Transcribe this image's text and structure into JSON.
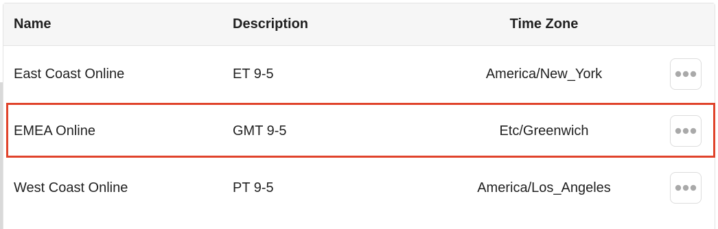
{
  "table": {
    "headers": {
      "name": "Name",
      "description": "Description",
      "time_zone": "Time Zone"
    },
    "rows": [
      {
        "name": "East Coast Online",
        "description": "ET 9-5",
        "time_zone": "America/New_York",
        "action_icon": "more-horizontal-icon"
      },
      {
        "name": "EMEA Online",
        "description": "GMT 9-5",
        "time_zone": "Etc/Greenwich",
        "action_icon": "more-horizontal-icon"
      },
      {
        "name": "West Coast Online",
        "description": "PT 9-5",
        "time_zone": "America/Los_Angeles",
        "action_icon": "more-horizontal-icon"
      }
    ]
  },
  "colors": {
    "highlight": "#e0432b",
    "header_bg": "#f6f6f6",
    "icon_dots": "#a9a9a9"
  }
}
